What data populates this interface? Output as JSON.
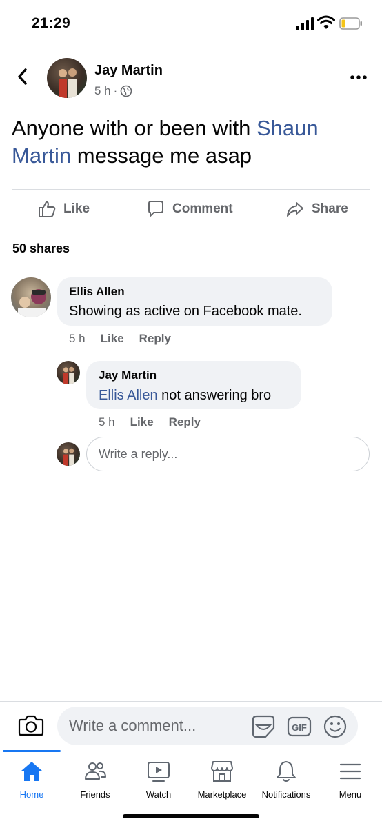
{
  "status_bar": {
    "time": "21:29"
  },
  "post": {
    "author": "Jay Martin",
    "time": "5 h",
    "separator": "·",
    "text_before": "Anyone with or been with ",
    "mention": "Shaun Martin",
    "text_after": " message me asap",
    "actions": {
      "like": "Like",
      "comment": "Comment",
      "share": "Share"
    },
    "shares_count": "50 shares"
  },
  "comments": [
    {
      "author": "Ellis Allen",
      "text": "Showing as active on Facebook mate.",
      "time": "5 h",
      "like_label": "Like",
      "reply_label": "Reply"
    }
  ],
  "replies": [
    {
      "author": "Jay Martin",
      "mention": "Ellis Allen",
      "text": " not answering bro",
      "time": "5 h",
      "like_label": "Like",
      "reply_label": "Reply"
    }
  ],
  "reply_input": {
    "placeholder": "Write a reply..."
  },
  "composer": {
    "placeholder": "Write a comment..."
  },
  "tabs": [
    {
      "label": "Home",
      "icon": "home-icon",
      "active": true
    },
    {
      "label": "Friends",
      "icon": "friends-icon"
    },
    {
      "label": "Watch",
      "icon": "watch-icon"
    },
    {
      "label": "Marketplace",
      "icon": "marketplace-icon"
    },
    {
      "label": "Notifications",
      "icon": "bell-icon"
    },
    {
      "label": "Menu",
      "icon": "menu-icon"
    }
  ],
  "colors": {
    "accent": "#1877f2",
    "mention": "#385898",
    "secondary_text": "#65676b",
    "bubble": "#f0f2f5"
  }
}
